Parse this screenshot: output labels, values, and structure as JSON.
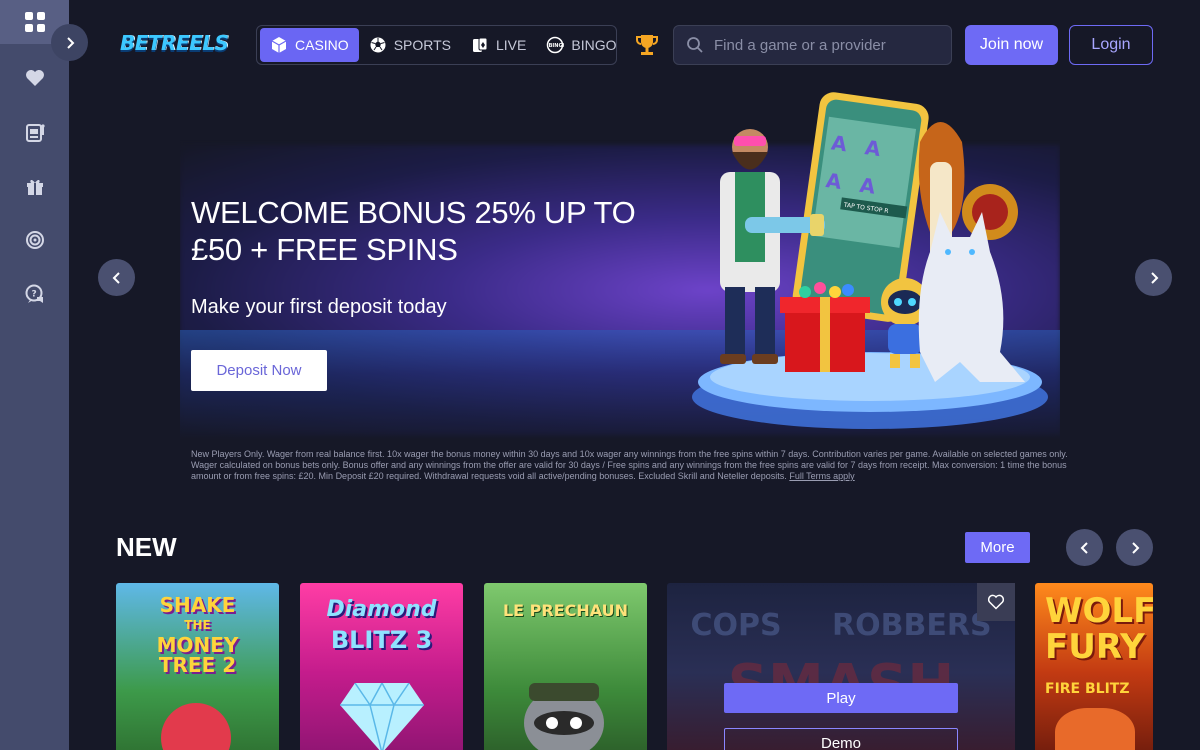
{
  "header": {
    "logo_text": "BETREELS",
    "tabs": [
      {
        "label": "CASINO",
        "icon": "cube-icon",
        "active": true
      },
      {
        "label": "SPORTS",
        "icon": "soccer-ball-icon",
        "active": false
      },
      {
        "label": "LIVE",
        "icon": "live-cards-icon",
        "active": false
      },
      {
        "label": "BINGO",
        "icon": "bingo-ball-icon",
        "active": false
      }
    ],
    "search_placeholder": "Find a game or a provider",
    "join_label": "Join now",
    "login_label": "Login"
  },
  "sidebar": {
    "items": [
      {
        "icon": "grid-icon",
        "active": true
      },
      {
        "icon": "heart-icon"
      },
      {
        "icon": "slot-machine-icon"
      },
      {
        "icon": "gift-icon"
      },
      {
        "icon": "target-icon"
      },
      {
        "icon": "chat-help-icon"
      }
    ]
  },
  "banner": {
    "title_line1": "WELCOME BONUS 25% UP TO",
    "title_line2": "£50 + FREE SPINS",
    "subtitle": "Make your first deposit today",
    "cta_label": "Deposit Now",
    "terms_text": "New Players Only. Wager from real balance first. 10x wager the bonus money within 30 days and 10x wager any winnings from the free spins within 7 days. Contribution varies per game. Available on selected games only. Wager calculated on bonus bets only. Bonus offer and any winnings from the offer are valid for 30 days / Free spins and any winnings from the free spins are valid for 7 days from receipt. Max conversion: 1 time the bonus amount or from free spins: £20. Min Deposit £20 required. Withdrawal requests void all active/pending bonuses. Excluded Skrill and Neteller deposits.",
    "terms_link": "Full Terms apply",
    "phone_text": "TAP TO STOP R"
  },
  "new_section": {
    "title": "NEW",
    "more_label": "More",
    "games": [
      {
        "title_lines": [
          "SHAKE",
          "THE",
          "MONEY",
          "TREE 2"
        ]
      },
      {
        "title_lines": [
          "Diamond",
          "BLITZ 3"
        ]
      },
      {
        "title_lines": [
          "LE PRECHAUN"
        ]
      },
      {
        "title_lines": [
          "COPS",
          "ROBBERS",
          "SMASH"
        ],
        "play_label": "Play",
        "demo_label": "Demo"
      },
      {
        "title_lines": [
          "WOLF",
          "FURY",
          "FIRE BLITZ"
        ]
      }
    ]
  },
  "colors": {
    "accent": "#6e6af5",
    "sidebar": "#444b6c",
    "background": "#161827"
  }
}
